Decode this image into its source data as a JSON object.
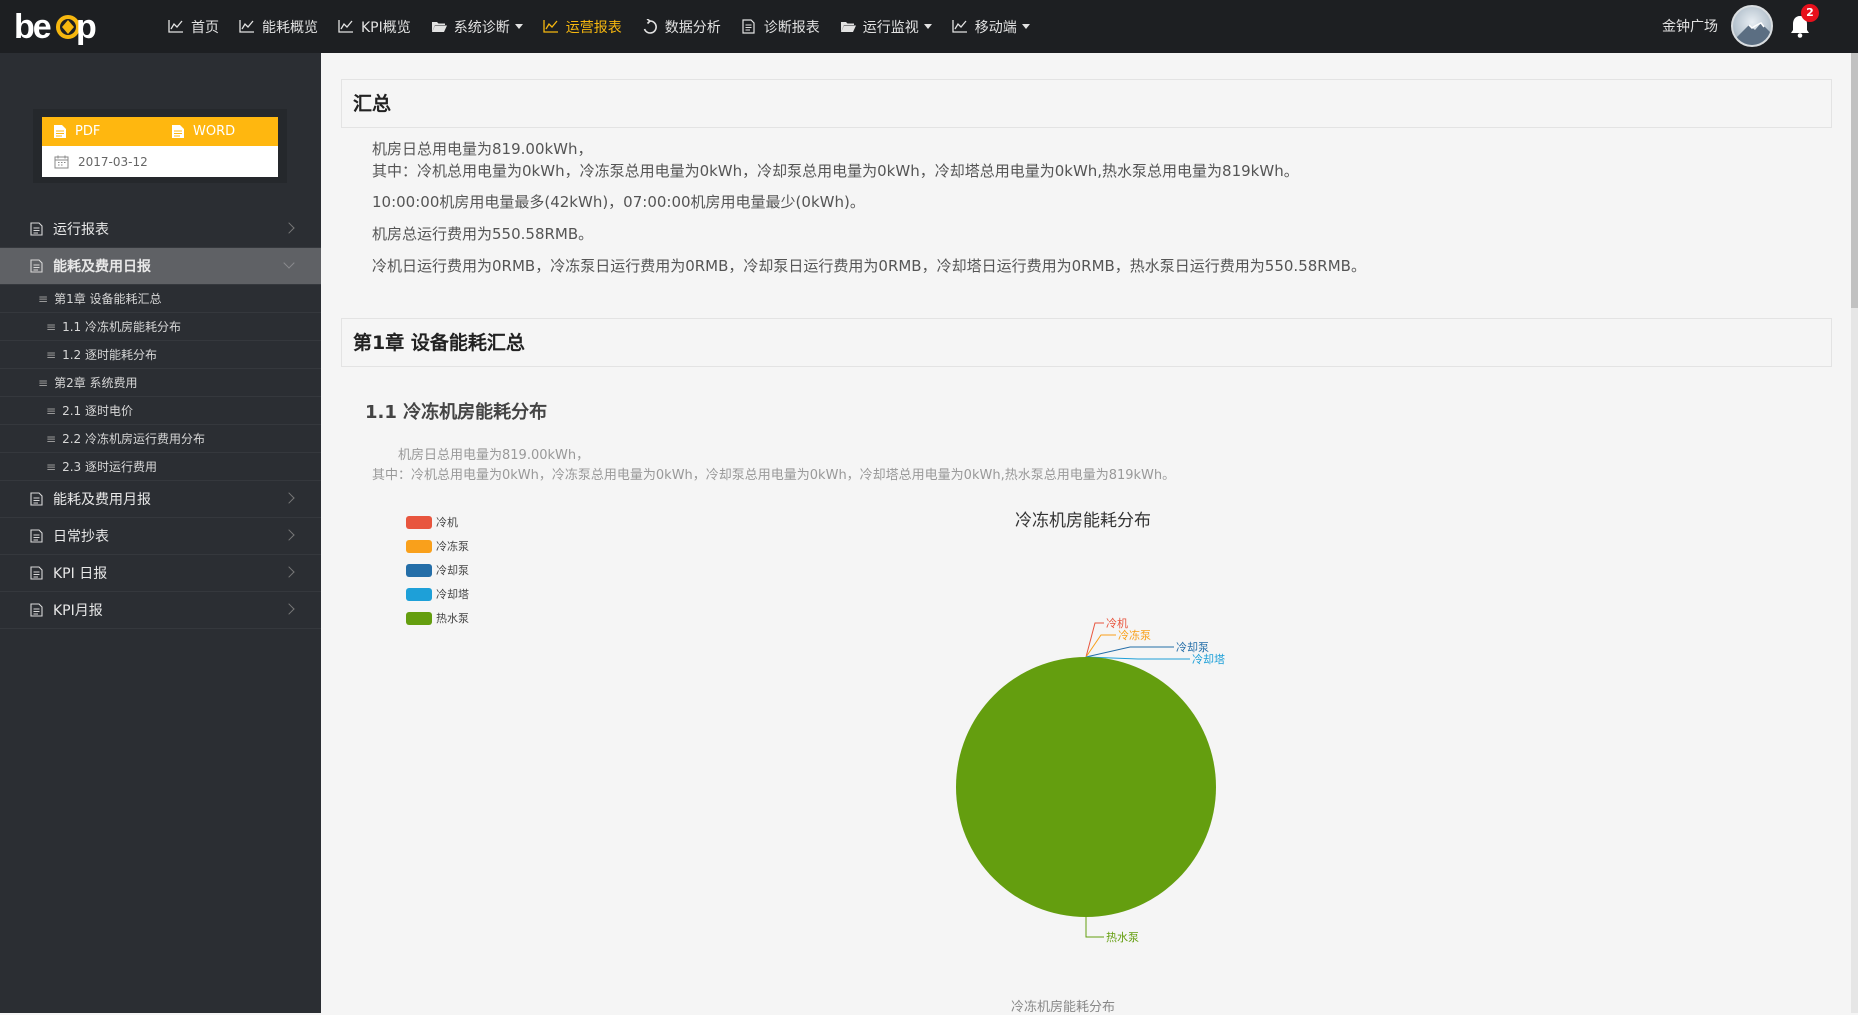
{
  "app": {
    "logo_text": "beep"
  },
  "nav": {
    "items": [
      {
        "label": "首页",
        "icon": "line-chart-icon",
        "active": false,
        "dropdown": false
      },
      {
        "label": "能耗概览",
        "icon": "line-chart-icon",
        "active": false,
        "dropdown": false
      },
      {
        "label": "KPI概览",
        "icon": "line-chart-icon",
        "active": false,
        "dropdown": false
      },
      {
        "label": "系统诊断",
        "icon": "folder-open-icon",
        "active": false,
        "dropdown": true
      },
      {
        "label": "运营报表",
        "icon": "line-chart-icon",
        "active": true,
        "dropdown": false
      },
      {
        "label": "数据分析",
        "icon": "refresh-icon",
        "active": false,
        "dropdown": false
      },
      {
        "label": "诊断报表",
        "icon": "document-icon",
        "active": false,
        "dropdown": false
      },
      {
        "label": "运行监视",
        "icon": "folder-open-icon",
        "active": false,
        "dropdown": true
      },
      {
        "label": "移动端",
        "icon": "line-chart-icon",
        "active": false,
        "dropdown": true
      }
    ],
    "active_color": "#f6b70f"
  },
  "user": {
    "name": "金钟广场",
    "notification_count": "2"
  },
  "export": {
    "pdf_label": "PDF",
    "word_label": "WORD",
    "date": "2017-03-12",
    "bar_color": "#ffb70f"
  },
  "sidebar": {
    "items": [
      {
        "label": "运行报表",
        "active": false
      },
      {
        "label": "能耗及费用日报",
        "active": true
      },
      {
        "label": "能耗及费用月报",
        "active": false
      },
      {
        "label": "日常抄表",
        "active": false
      },
      {
        "label": "KPI 日报",
        "active": false
      },
      {
        "label": "KPI月报",
        "active": false
      }
    ],
    "sub_items": [
      {
        "label": "第1章 设备能耗汇总",
        "level": 1
      },
      {
        "label": "1.1 冷冻机房能耗分布",
        "level": 2
      },
      {
        "label": "1.2 逐时能耗分布",
        "level": 2
      },
      {
        "label": "第2章 系统费用",
        "level": 1
      },
      {
        "label": "2.1 逐时电价",
        "level": 2
      },
      {
        "label": "2.2 冷冻机房运行费用分布",
        "level": 2
      },
      {
        "label": "2.3 逐时运行费用",
        "level": 2
      }
    ]
  },
  "summary": {
    "title": "汇总",
    "lines": [
      "机房日总用电量为819.00kWh，",
      "其中：冷机总用电量为0kWh，冷冻泵总用电量为0kWh，冷却泵总用电量为0kWh，冷却塔总用电量为0kWh,热水泵总用电量为819kWh。",
      "10:00:00机房用电量最多(42kWh)，07:00:00机房用电量最少(0kWh)。",
      "机房总运行费用为550.58RMB。",
      "冷机日运行费用为0RMB，冷冻泵日运行费用为0RMB，冷却泵日运行费用为0RMB，冷却塔日运行费用为0RMB，热水泵日运行费用为550.58RMB。"
    ]
  },
  "chapter1": {
    "title": "第1章 设备能耗汇总",
    "section_title": "1.1 冷冻机房能耗分布",
    "desc_lines": [
      "机房日总用电量为819.00kWh，",
      "其中：冷机总用电量为0kWh，冷冻泵总用电量为0kWh，冷却泵总用电量为0kWh，冷却塔总用电量为0kWh,热水泵总用电量为819kWh。"
    ],
    "caption": "冷冻机房能耗分布"
  },
  "chart_data": {
    "type": "pie",
    "title": "冷冻机房能耗分布",
    "categories": [
      "冷机",
      "冷冻泵",
      "冷却泵",
      "冷却塔",
      "热水泵"
    ],
    "values": [
      0,
      0,
      0,
      0,
      819
    ],
    "unit": "kWh",
    "colors": [
      "#e8553e",
      "#f9a01b",
      "#246ea8",
      "#1ea0d8",
      "#649e0f"
    ],
    "legend": "top-left"
  }
}
